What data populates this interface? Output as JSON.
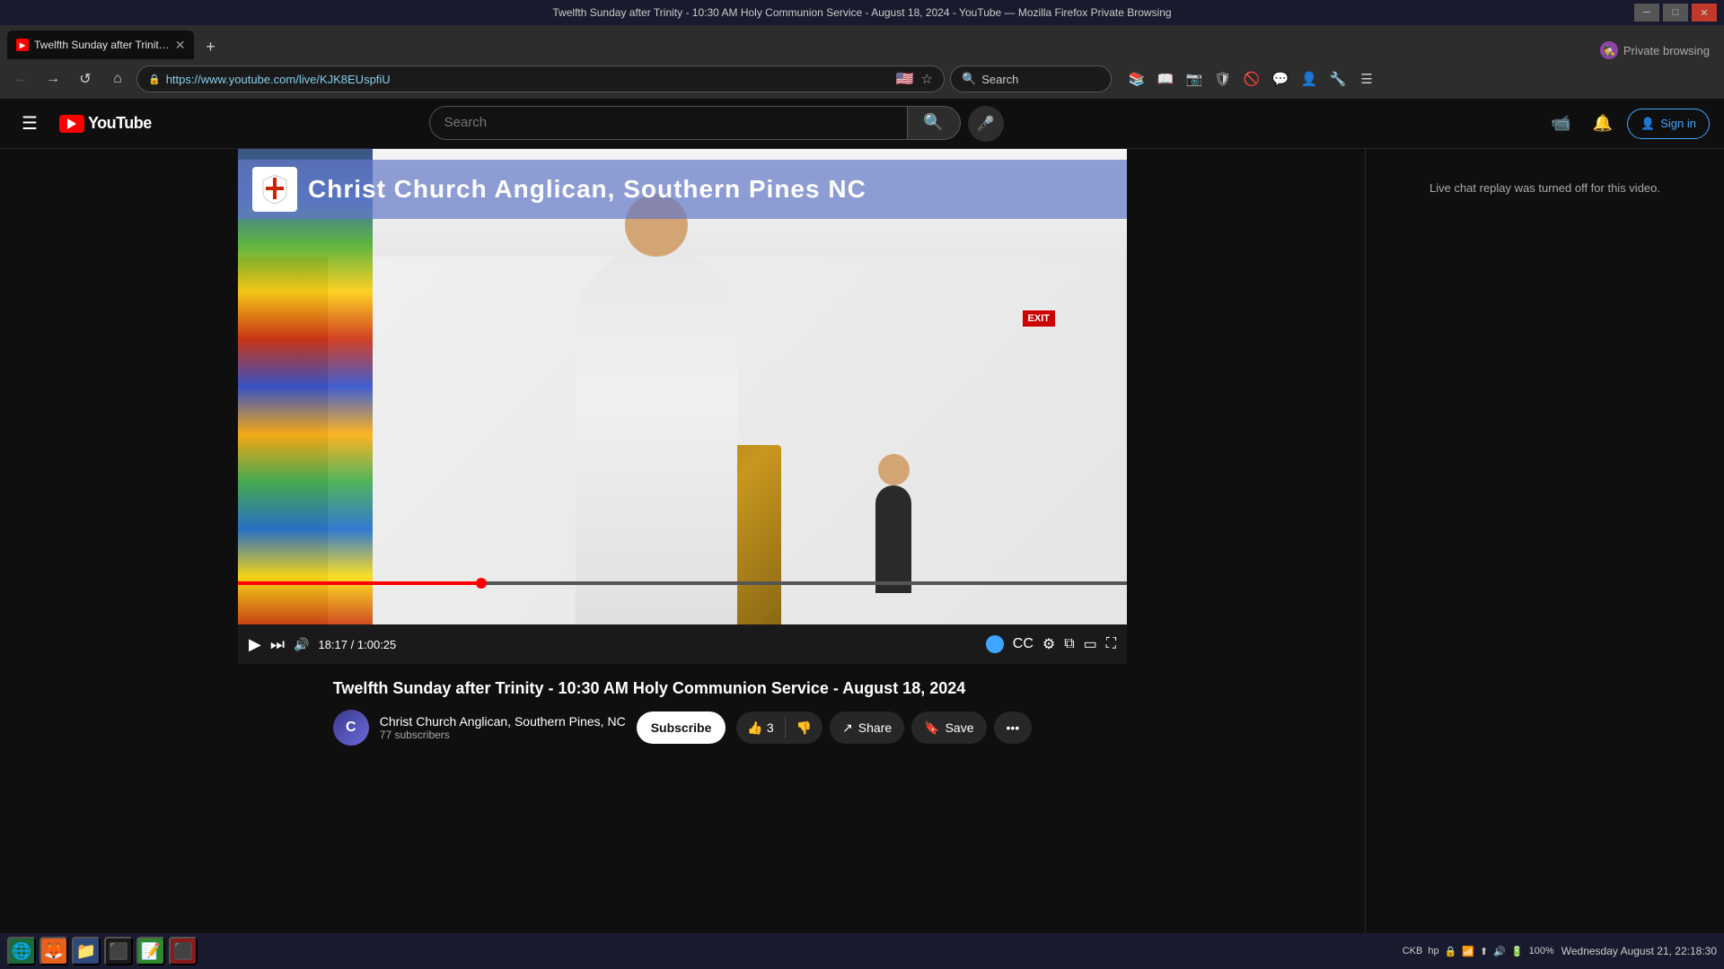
{
  "window": {
    "title": "Twelfth Sunday after Trinity - 10:30 AM Holy Communion Service - August 18, 2024 - YouTube — Mozilla Firefox Private Browsing",
    "tab_title": "Twelfth Sunday after Trinit…",
    "tab_favicon_letter": "▶"
  },
  "browser": {
    "back_btn": "←",
    "forward_btn": "→",
    "refresh_btn": "↺",
    "home_btn": "⌂",
    "url": "https://www.youtube.com/live/KJK8EUspfiU",
    "search_label": "Search",
    "private_label": "Private browsing"
  },
  "youtube": {
    "logo_text": "YouTube",
    "search_placeholder": "Search",
    "sign_in_label": "Sign in",
    "menu_icon": "☰"
  },
  "video": {
    "banner_title": "Christ Church Anglican, Southern Pines NC",
    "church_shield": "✝",
    "title": "Twelfth Sunday after Trinity - 10:30 AM Holy Communion Service - August 18, 2024",
    "exit_sign": "EXIT",
    "time_current": "18:17",
    "time_total": "1:00:25",
    "progress_percent": 28
  },
  "channel": {
    "name": "Christ Church Anglican, Southern Pines, NC",
    "subscribers": "77 subscribers",
    "avatar_text": "C"
  },
  "actions": {
    "subscribe": "Subscribe",
    "like_count": "3",
    "share_label": "Share",
    "save_label": "Save"
  },
  "chat": {
    "message": "Live chat replay was turned off for this video."
  },
  "controls": {
    "play": "▶",
    "next": "⏭",
    "volume": "🔊",
    "settings": "⚙",
    "cc": "CC",
    "miniplayer": "⧉",
    "theater": "▭",
    "fullscreen": "⛶",
    "pip": "⊡"
  },
  "taskbar": {
    "apps": [
      "🌐",
      "📁",
      "⚙",
      "📋",
      "📝",
      "🔴"
    ],
    "time": "Wednesday August 21, 22:18:30",
    "battery": "100%",
    "keyboard_layout": "CKB"
  }
}
